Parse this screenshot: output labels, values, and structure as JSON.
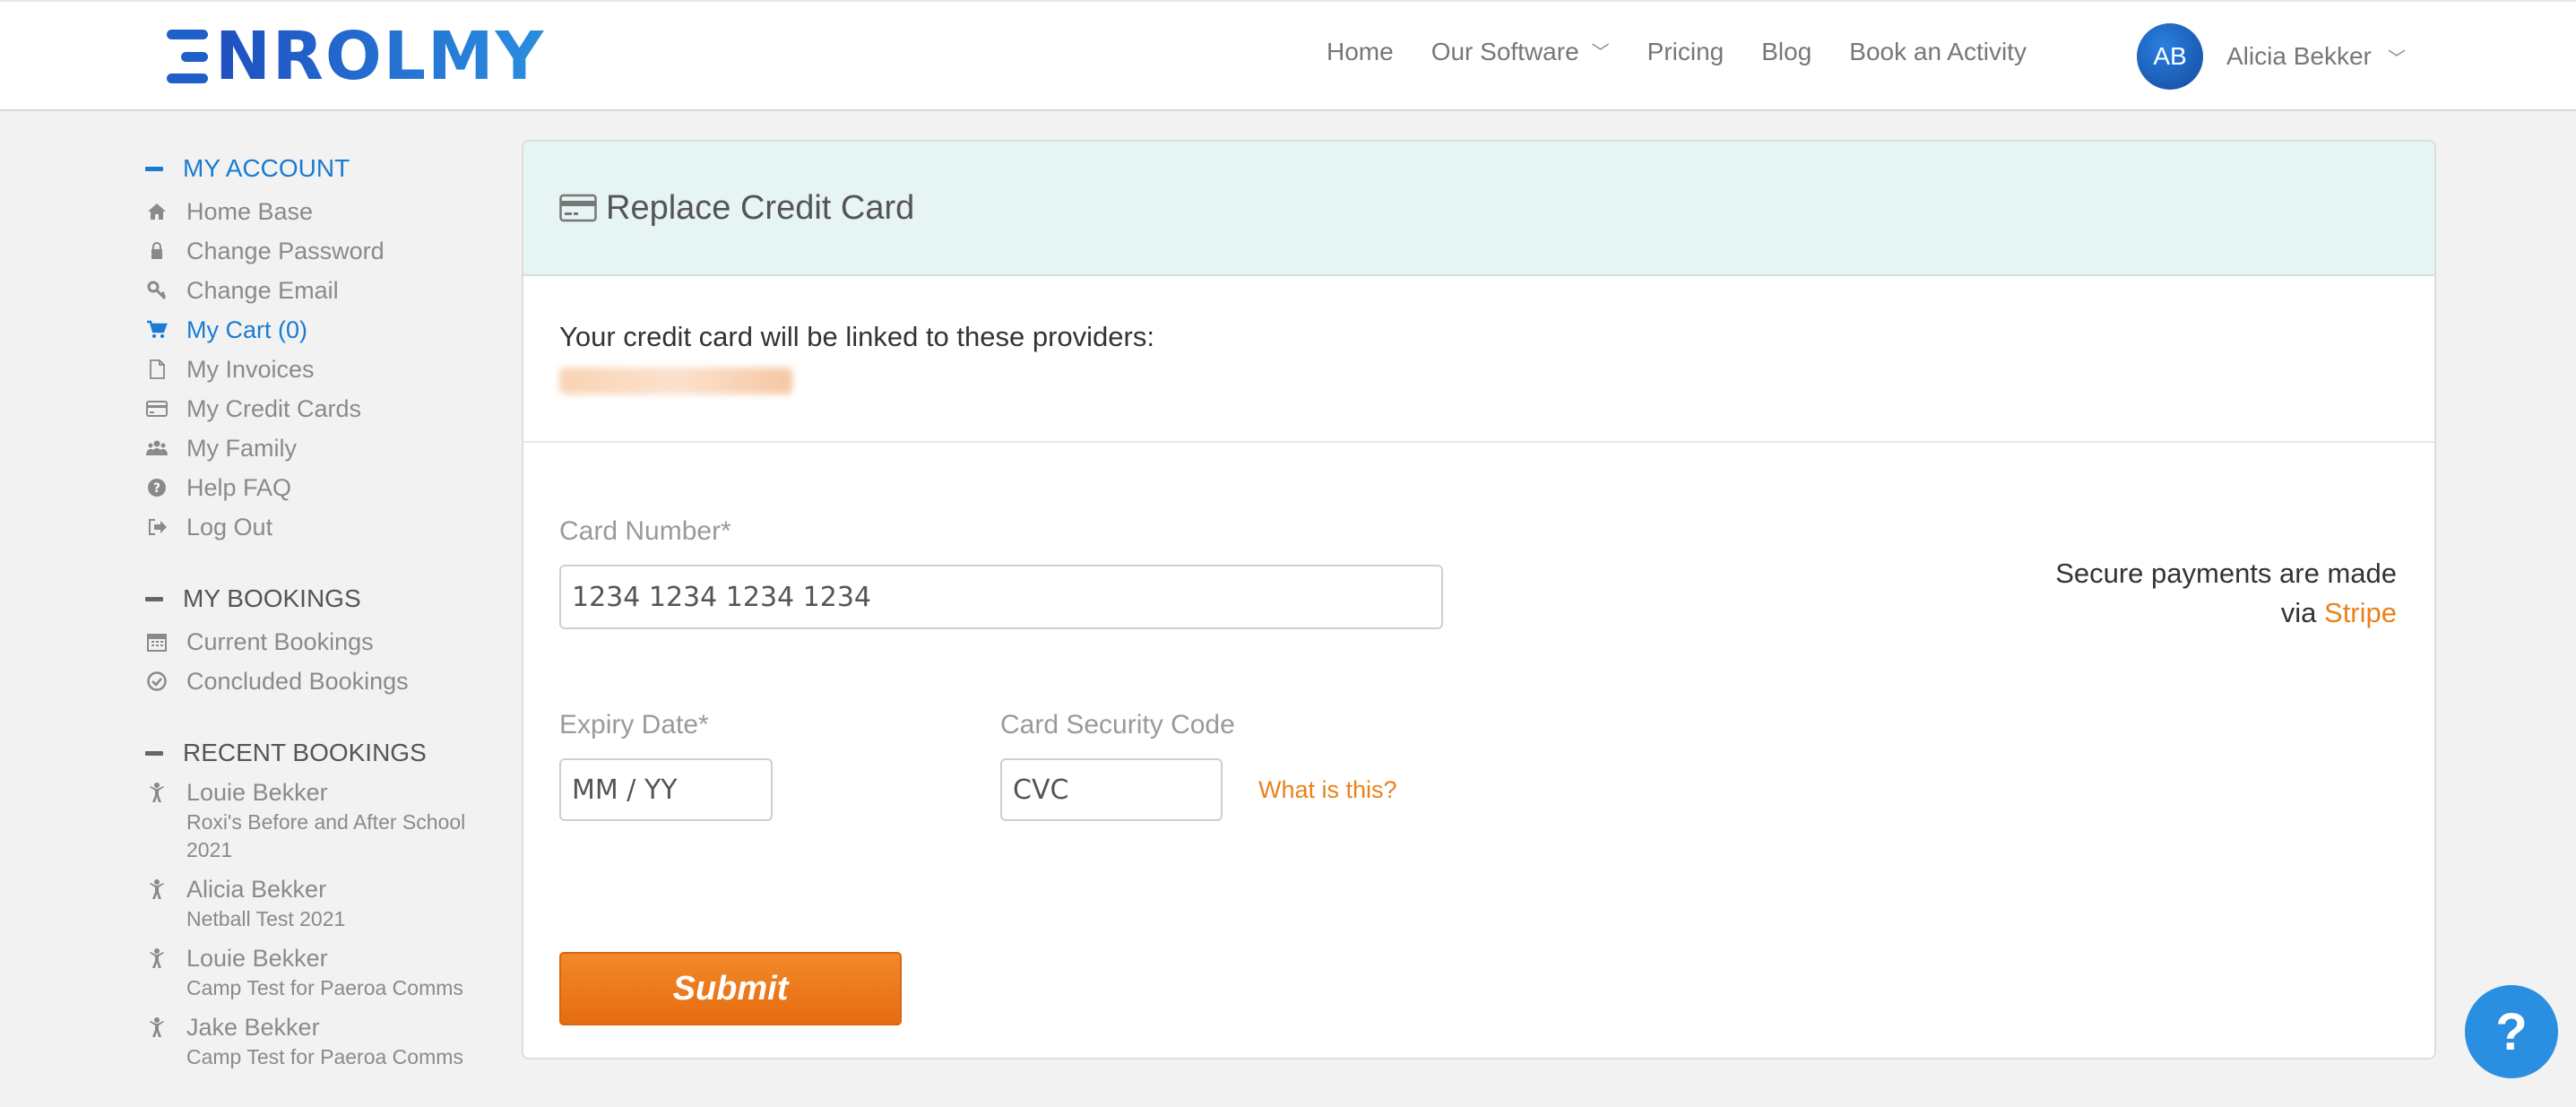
{
  "logo": {
    "text": "NROLMY",
    "brand": "ENROLMY"
  },
  "nav": {
    "items": [
      {
        "label": "Home"
      },
      {
        "label": "Our Software",
        "dropdown": true
      },
      {
        "label": "Pricing"
      },
      {
        "label": "Blog"
      },
      {
        "label": "Book an Activity"
      }
    ],
    "user": {
      "initials": "AB",
      "name": "Alicia Bekker"
    }
  },
  "sidebar": {
    "my_account": {
      "title": "MY ACCOUNT",
      "items": [
        {
          "label": "Home Base",
          "icon": "home-icon"
        },
        {
          "label": "Change Password",
          "icon": "lock-icon"
        },
        {
          "label": "Change Email",
          "icon": "key-icon"
        },
        {
          "label": "My Cart (0)",
          "icon": "cart-icon",
          "active": true
        },
        {
          "label": "My Invoices",
          "icon": "document-icon"
        },
        {
          "label": "My Credit Cards",
          "icon": "credit-card-icon"
        },
        {
          "label": "My Family",
          "icon": "family-icon"
        },
        {
          "label": "Help FAQ",
          "icon": "question-icon"
        },
        {
          "label": "Log Out",
          "icon": "logout-icon"
        }
      ]
    },
    "my_bookings": {
      "title": "MY BOOKINGS",
      "items": [
        {
          "label": "Current Bookings",
          "icon": "calendar-icon"
        },
        {
          "label": "Concluded Bookings",
          "icon": "check-circle-icon"
        }
      ]
    },
    "recent_bookings": {
      "title": "RECENT BOOKINGS",
      "items": [
        {
          "name": "Louie Bekker",
          "activity": "Roxi's Before and After School 2021"
        },
        {
          "name": "Alicia Bekker",
          "activity": "Netball Test 2021"
        },
        {
          "name": "Louie Bekker",
          "activity": "Camp Test for Paeroa Comms"
        },
        {
          "name": "Jake Bekker",
          "activity": "Camp Test for Paeroa Comms"
        }
      ]
    }
  },
  "card": {
    "title": "Replace Credit Card",
    "providers_label": "Your credit card will be linked to these providers:",
    "card_number": {
      "label": "Card Number*",
      "placeholder": "1234 1234 1234 1234"
    },
    "expiry": {
      "label": "Expiry Date*",
      "placeholder": "MM / YY"
    },
    "cvc": {
      "label": "Card Security Code",
      "placeholder": "CVC",
      "help_link": "What is this?"
    },
    "secure_text_line1": "Secure payments are made",
    "secure_text_via": "via",
    "secure_provider": "Stripe",
    "submit_label": "Submit"
  },
  "help_button": {
    "label": "?"
  },
  "colors": {
    "brand_blue": "#1a7bd1",
    "accent_orange": "#e8821a",
    "header_tint": "#e6f4f3"
  }
}
